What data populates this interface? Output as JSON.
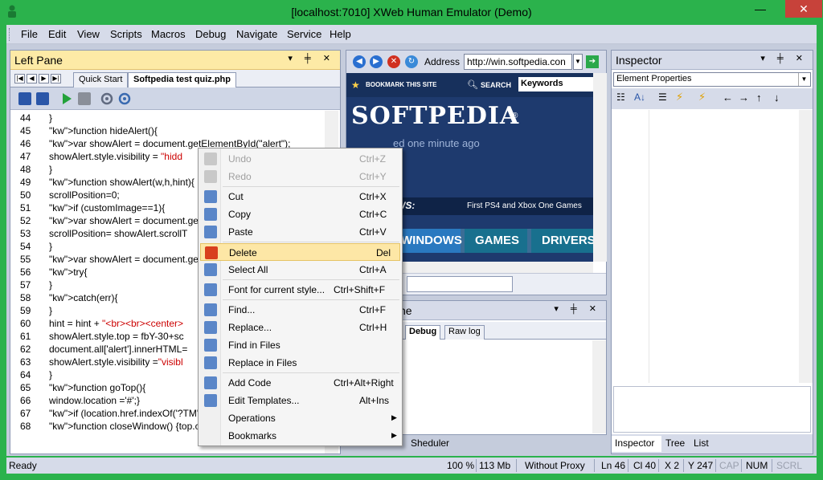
{
  "window": {
    "title": "[localhost:7010] XWeb Human Emulator (Demo)",
    "min_glyph": "—",
    "max_glyph": "☐",
    "close_glyph": "✕"
  },
  "menu": [
    "File",
    "Edit",
    "View",
    "Scripts",
    "Macros",
    "Debug",
    "Navigate",
    "Service",
    "Help"
  ],
  "left_pane": {
    "title": "Left Pane",
    "controls": "▾ ╪ ✕",
    "tabs": [
      "Quick Start",
      "Softpedia test quiz.php"
    ]
  },
  "code_lines": [
    {
      "n": "44",
      "t": "}"
    },
    {
      "n": "45",
      "t": "function hideAlert(){"
    },
    {
      "n": "46",
      "t": "var showAlert = document.getElementById(\"alert\");"
    },
    {
      "n": "47",
      "t": "showAlert.style.visibility = \"hidd"
    },
    {
      "n": "48",
      "t": "}"
    },
    {
      "n": "49",
      "t": "function showAlert(w,h,hint){"
    },
    {
      "n": "50",
      "t": "scrollPosition=0;"
    },
    {
      "n": "51",
      "t": "if (customImage==1){"
    },
    {
      "n": "52",
      "t": "var showAlert = document.getEl"
    },
    {
      "n": "53",
      "t": "scrollPosition= showAlert.scrollT"
    },
    {
      "n": "54",
      "t": "}"
    },
    {
      "n": "55",
      "t": "var showAlert = document.getEl"
    },
    {
      "n": "56",
      "t": "try{"
    },
    {
      "n": "57",
      "t": "}"
    },
    {
      "n": "58",
      "t": "catch(err){"
    },
    {
      "n": "59",
      "t": "}"
    },
    {
      "n": "60",
      "t": "hint = hint + \"<br><br><center>"
    },
    {
      "n": "61",
      "t": "showAlert.style.top = fbY-30+sc"
    },
    {
      "n": "62",
      "t": "document.all['alert'].innerHTML="
    },
    {
      "n": "63",
      "t": "showAlert.style.visibility =\"visibl"
    },
    {
      "n": "64",
      "t": "}"
    },
    {
      "n": "65",
      "t": "function goTop(){"
    },
    {
      "n": "66",
      "t": "window.location ='#';}"
    },
    {
      "n": "67",
      "t": "if (location.href.indexOf('?TM') !="
    },
    {
      "n": "68",
      "t": "function closeWindow() {top.clos"
    }
  ],
  "browser": {
    "address_label": "Address",
    "address_value": "http://win.softpedia.con",
    "bookmark_text": "BOOKMARK THIS SITE",
    "search_text": "SEARCH",
    "search_placeholder": "Keywords",
    "logo": "SOFTPEDIA",
    "updated_text": "ed one minute ago",
    "news_label": "WS:",
    "news_headline": "First PS4 and Xbox One Games",
    "nav_tabs": [
      "WINDOWS",
      "GAMES",
      "DRIVERS"
    ]
  },
  "log_pane": {
    "title_fragment": "ne",
    "controls": "▾ ╪ ✕",
    "tabs": [
      "Debug",
      "Raw log"
    ]
  },
  "inspector": {
    "title": "Inspector",
    "controls": "▾ ╪ ✕",
    "select_value": "Element Properties",
    "bottom_tabs": [
      "Inspector",
      "Tree",
      "List"
    ]
  },
  "sheduler_label": "Sheduler",
  "context_menu": [
    {
      "label": "Undo",
      "shortcut": "Ctrl+Z",
      "disabled": true,
      "icon": "undo-icon"
    },
    {
      "label": "Redo",
      "shortcut": "Ctrl+Y",
      "disabled": true,
      "icon": "redo-icon"
    },
    {
      "sep": true
    },
    {
      "label": "Cut",
      "shortcut": "Ctrl+X",
      "icon": "cut-icon"
    },
    {
      "label": "Copy",
      "shortcut": "Ctrl+C",
      "icon": "copy-icon"
    },
    {
      "label": "Paste",
      "shortcut": "Ctrl+V",
      "icon": "paste-icon"
    },
    {
      "sep": true
    },
    {
      "label": "Delete",
      "shortcut": "Del",
      "highlight": true,
      "icon": "delete-icon"
    },
    {
      "label": "Select All",
      "shortcut": "Ctrl+A",
      "icon": "select-all-icon"
    },
    {
      "sep": true
    },
    {
      "label": "Font for current style...",
      "shortcut": "Ctrl+Shift+F",
      "icon": "font-icon"
    },
    {
      "sep": true
    },
    {
      "label": "Find...",
      "shortcut": "Ctrl+F",
      "icon": "find-icon"
    },
    {
      "label": "Replace...",
      "shortcut": "Ctrl+H",
      "icon": "replace-icon"
    },
    {
      "label": "Find in Files",
      "shortcut": "",
      "icon": "find-in-files-icon"
    },
    {
      "label": "Replace in Files",
      "shortcut": "",
      "icon": "replace-in-files-icon"
    },
    {
      "sep": true
    },
    {
      "label": "Add Code",
      "shortcut": "Ctrl+Alt+Right",
      "icon": "add-code-icon"
    },
    {
      "label": "Edit Templates...",
      "shortcut": "Alt+Ins",
      "icon": "edit-templates-icon"
    },
    {
      "label": "Operations",
      "shortcut": "",
      "submenu": true
    },
    {
      "label": "Bookmarks",
      "shortcut": "",
      "submenu": true
    }
  ],
  "status": {
    "ready": "Ready",
    "zoom": "100 %",
    "memory": "113 Mb",
    "proxy": "Without Proxy",
    "line": "Ln 46",
    "col": "Cl 40",
    "x": "X 2",
    "y": "Y 247",
    "cap": "CAP",
    "num": "NUM",
    "scrl": "SCRL"
  },
  "colors": {
    "window_frame": "#2bb24c",
    "pane_header": "#fdeaa6",
    "highlight": "#fde7a6",
    "keyword": "#0000ff",
    "string": "#cc0000"
  }
}
